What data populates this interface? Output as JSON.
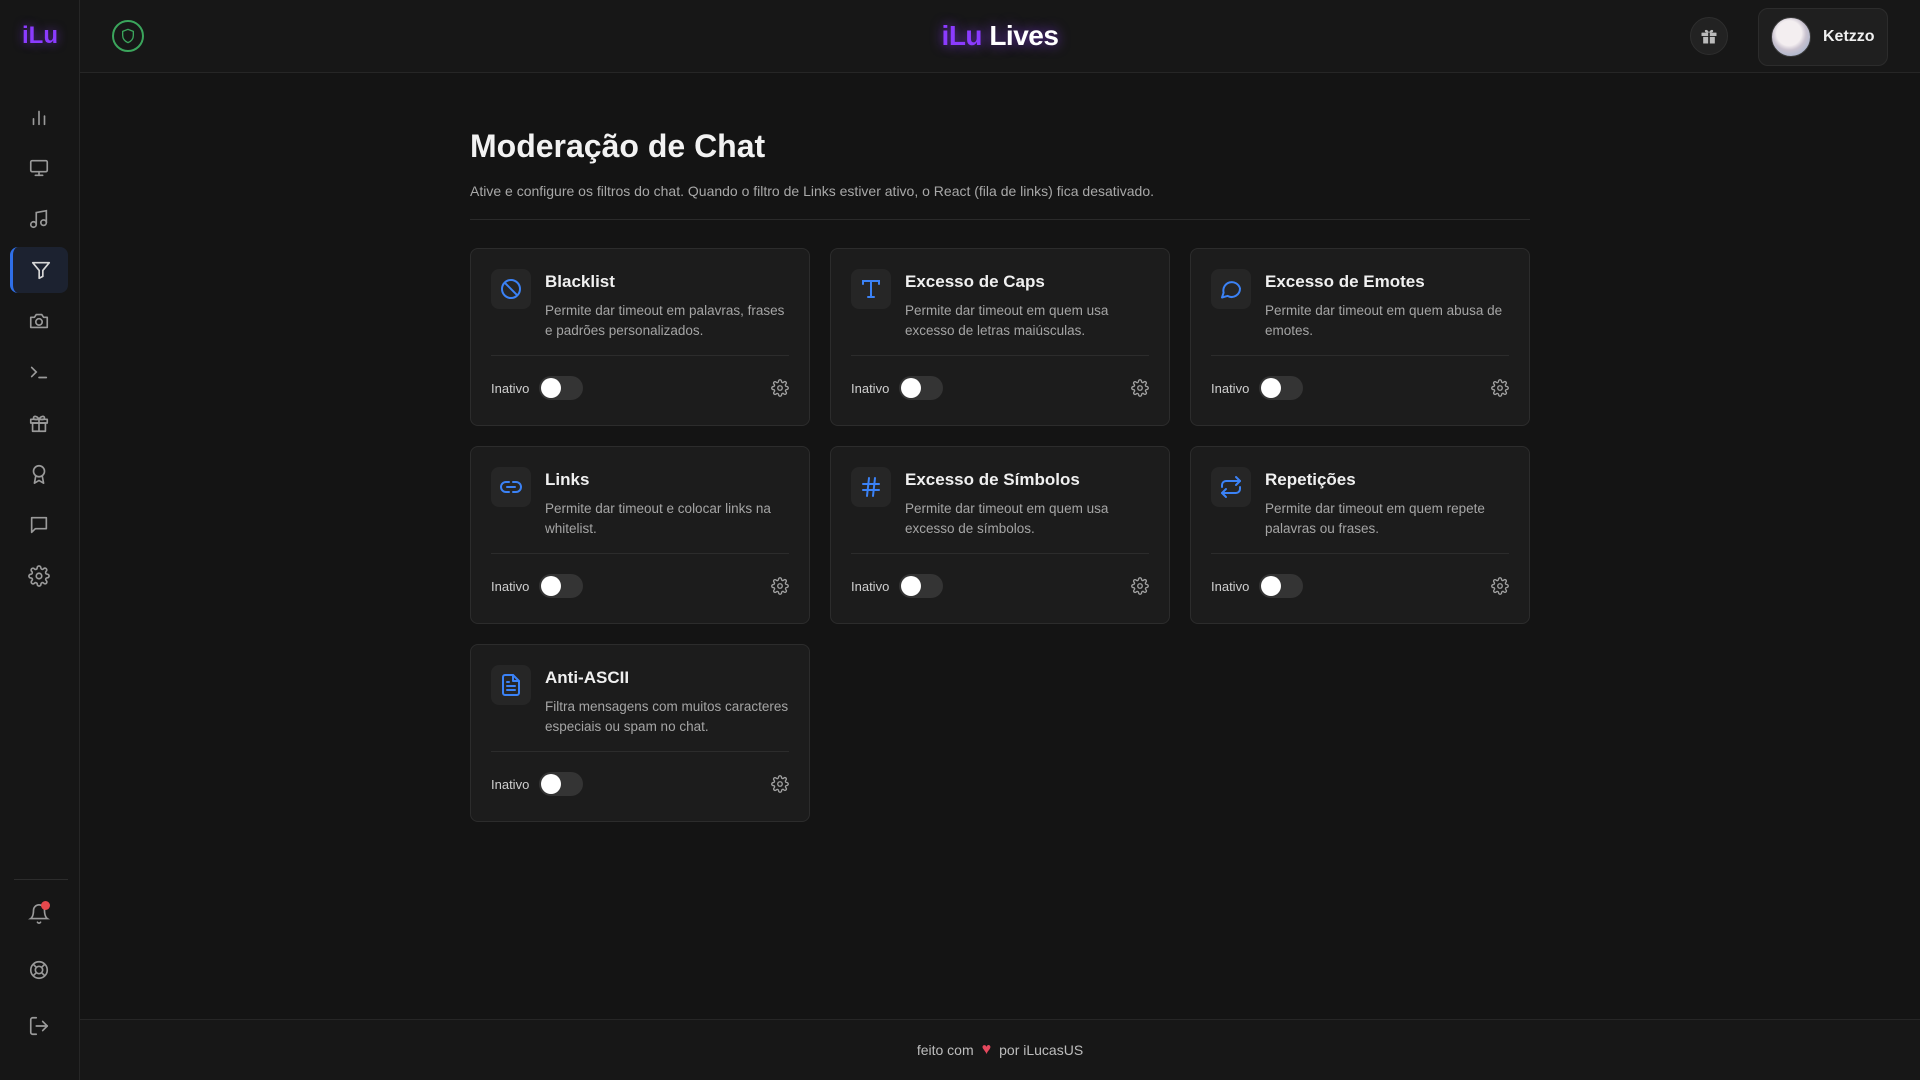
{
  "sidebar": {
    "logo": "iLu",
    "items": [
      {
        "name": "stats",
        "icon": "bar-chart-icon"
      },
      {
        "name": "screen",
        "icon": "monitor-icon"
      },
      {
        "name": "music",
        "icon": "music-note-icon"
      },
      {
        "name": "moderation",
        "icon": "filter-icon",
        "active": true
      },
      {
        "name": "camera",
        "icon": "camera-icon"
      },
      {
        "name": "commands",
        "icon": "terminal-icon"
      },
      {
        "name": "rewards",
        "icon": "gift-icon"
      },
      {
        "name": "achievements",
        "icon": "award-icon"
      },
      {
        "name": "chat",
        "icon": "message-square-icon"
      },
      {
        "name": "settings",
        "icon": "gear-icon"
      }
    ],
    "bottom": [
      {
        "name": "notifications",
        "icon": "bell-icon",
        "has_badge": true
      },
      {
        "name": "help",
        "icon": "lifebuoy-icon"
      },
      {
        "name": "logout",
        "icon": "logout-icon"
      }
    ]
  },
  "header": {
    "shield_icon": "shield-icon",
    "brand_part1": "iLu",
    "brand_part2": "Lives",
    "gift_icon": "gift-icon",
    "user_name": "Ketzzo"
  },
  "main": {
    "title": "Moderação de Chat",
    "description": "Ative e configure os filtros do chat. Quando o filtro de Links estiver ativo, o React (fila de links) fica desativado.",
    "cards": [
      {
        "title": "Blacklist",
        "description": "Permite dar timeout em palavras, frases e padrões personalizados.",
        "status": "Inativo",
        "enabled": false,
        "icon": "ban-icon"
      },
      {
        "title": "Excesso de Caps",
        "description": "Permite dar timeout em quem usa excesso de letras maiúsculas.",
        "status": "Inativo",
        "enabled": false,
        "icon": "type-icon"
      },
      {
        "title": "Excesso de Emotes",
        "description": "Permite dar timeout em quem abusa de emotes.",
        "status": "Inativo",
        "enabled": false,
        "icon": "chat-bubble-icon"
      },
      {
        "title": "Links",
        "description": "Permite dar timeout e colocar links na whitelist.",
        "status": "Inativo",
        "enabled": false,
        "icon": "link-icon"
      },
      {
        "title": "Excesso de Símbolos",
        "description": "Permite dar timeout em quem usa excesso de símbolos.",
        "status": "Inativo",
        "enabled": false,
        "icon": "hash-icon"
      },
      {
        "title": "Repetições",
        "description": "Permite dar timeout em quem repete palavras ou frases.",
        "status": "Inativo",
        "enabled": false,
        "icon": "repeat-icon"
      },
      {
        "title": "Anti-ASCII",
        "description": "Filtra mensagens com muitos caracteres especiais ou spam no chat.",
        "status": "Inativo",
        "enabled": false,
        "icon": "file-text-icon"
      }
    ]
  },
  "footer": {
    "text_before": "feito com",
    "heart": "♥",
    "text_after": "por iLucasUS"
  },
  "colors": {
    "accent_purple": "#8b3bff",
    "accent_blue": "#3b82f6",
    "shield_green": "#3ba55c",
    "notification_red": "#e5484d"
  }
}
